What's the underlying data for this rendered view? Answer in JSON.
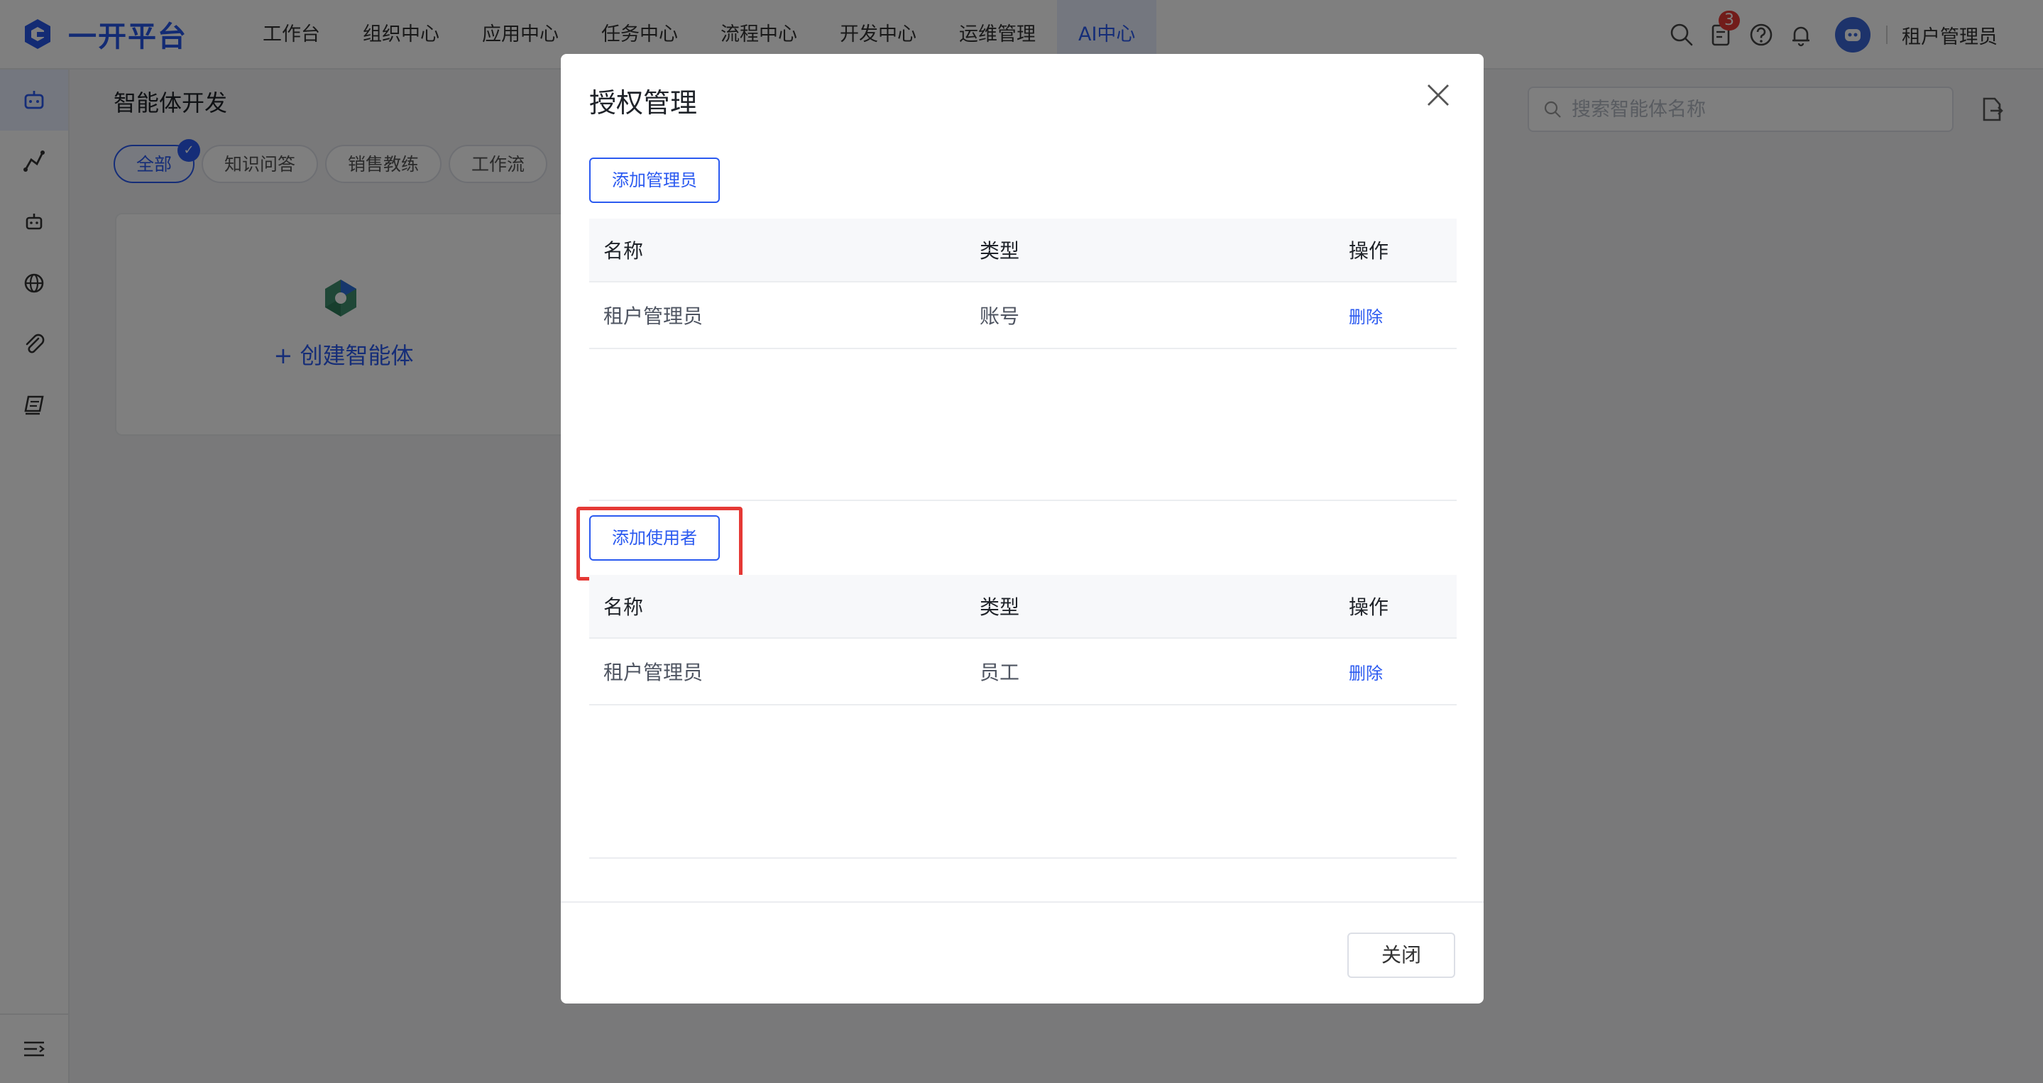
{
  "app": {
    "name": "一开平台",
    "brand_color": "#2756e8"
  },
  "nav": [
    {
      "label": "工作台"
    },
    {
      "label": "组织中心"
    },
    {
      "label": "应用中心"
    },
    {
      "label": "任务中心"
    },
    {
      "label": "流程中心"
    },
    {
      "label": "开发中心"
    },
    {
      "label": "运维管理"
    },
    {
      "label": "AI中心",
      "active": true
    }
  ],
  "header_tools": {
    "icons": [
      "search-icon",
      "todo-icon",
      "help-icon",
      "bell-icon",
      "avatar"
    ],
    "todo_badge": "3",
    "username": "租户管理员"
  },
  "rail": {
    "items": [
      "robot-icon",
      "flow-icon",
      "bot-icon",
      "globe-icon",
      "attachment-icon",
      "knowledge-icon"
    ],
    "active": "robot-icon",
    "bottom": "collapse-menu-icon"
  },
  "page": {
    "title": "智能体开发",
    "filters": [
      {
        "label": "全部",
        "active": true
      },
      {
        "label": "知识问答"
      },
      {
        "label": "销售教练"
      },
      {
        "label": "工作流"
      }
    ],
    "create_label": "+ 创建智能体",
    "search_placeholder": "搜索智能体名称"
  },
  "modal": {
    "title": "授权管理",
    "admins": {
      "add_label": "添加管理员",
      "columns": [
        "名称",
        "类型",
        "操作"
      ],
      "rows": [
        {
          "name": "租户管理员",
          "type": "账号",
          "action": "删除"
        }
      ]
    },
    "users": {
      "add_label": "添加使用者",
      "columns": [
        "名称",
        "类型",
        "操作"
      ],
      "rows": [
        {
          "name": "租户管理员",
          "type": "员工",
          "action": "删除"
        }
      ]
    },
    "close_label": "关闭",
    "highlight_color": "#e53935"
  }
}
